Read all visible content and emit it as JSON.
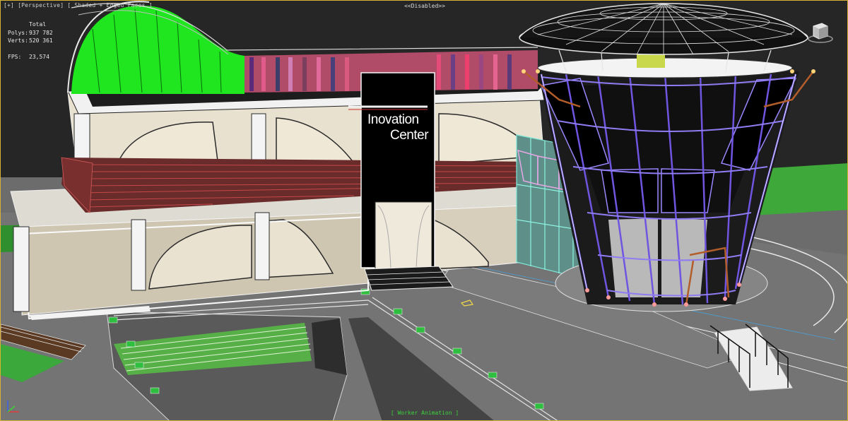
{
  "viewport": {
    "label": "[+] [Perspective] [ Shaded + Edged Faces ]",
    "disabled_text": "<<Disabled>>",
    "bottom_status": "[ Worker Animation ]"
  },
  "stats": {
    "header": "Total",
    "rows": [
      {
        "label": "Polys:",
        "value": "937 782"
      },
      {
        "label": "Verts:",
        "value": "520 361"
      },
      {
        "label": "",
        "value": ""
      },
      {
        "label": "FPS:",
        "value": "23,574"
      }
    ]
  },
  "building": {
    "sign_line1": "Inovation",
    "sign_line2": "Center"
  },
  "colors": {
    "frame_border": "#d4b233",
    "background": "#262626",
    "ground": "#6e6e6e",
    "grass": "#3ea83a",
    "roof_green": "#1fe61f",
    "tower_frame": "#6f55e0",
    "sign_panel": "#000000"
  },
  "icons": [
    "viewcube-icon",
    "axis-tripod-icon"
  ]
}
